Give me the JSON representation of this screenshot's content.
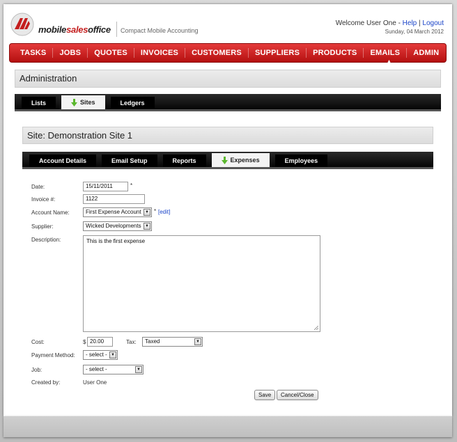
{
  "header": {
    "brand_part1": "mobile",
    "brand_part2": "sales",
    "brand_part3": "office",
    "tagline": "Compact Mobile Accounting",
    "welcome": "Welcome User One - ",
    "help": "Help",
    "separator": " | ",
    "logout": "Logout",
    "date": "Sunday, 04 March 2012",
    "brand_color": "#c41e1e"
  },
  "mainnav": {
    "items": [
      "TASKS",
      "JOBS",
      "QUOTES",
      "INVOICES",
      "CUSTOMERS",
      "SUPPLIERS",
      "PRODUCTS",
      "EMAILS",
      "ADMIN"
    ],
    "active": "ADMIN"
  },
  "admin": {
    "title": "Administration",
    "tabs": [
      "Lists",
      "Sites",
      "Ledgers"
    ],
    "active_tab": "Sites"
  },
  "site": {
    "title": "Site: Demonstration Site 1",
    "tabs": [
      "Account Details",
      "Email Setup",
      "Reports",
      "Expenses",
      "Employees"
    ],
    "active_tab": "Expenses"
  },
  "form": {
    "date_label": "Date:",
    "date_value": "15/11/2011",
    "required_mark": "*",
    "invoice_label": "Invoice #:",
    "invoice_value": "1122",
    "account_label": "Account Name:",
    "account_value": "First Expense Account",
    "edit_link": "[edit]",
    "supplier_label": "Supplier:",
    "supplier_value": "Wicked Developments",
    "description_label": "Description:",
    "description_value": "This is the first expense",
    "cost_label": "Cost:",
    "currency": "$",
    "cost_value": "20.00",
    "tax_label": "Tax:",
    "tax_value": "Taxed",
    "payment_label": "Payment Method:",
    "payment_value": "- select -",
    "job_label": "Job:",
    "job_value": "- select -",
    "created_label": "Created by:",
    "created_value": "User One",
    "save_button": "Save",
    "cancel_button": "Cancel/Close"
  },
  "icons": {
    "logo": "mobile-sales-office-logo",
    "tab_arrow": "green-down-arrow-icon",
    "dropdown": "chevron-down-icon",
    "resize": "resize-grip-icon"
  }
}
